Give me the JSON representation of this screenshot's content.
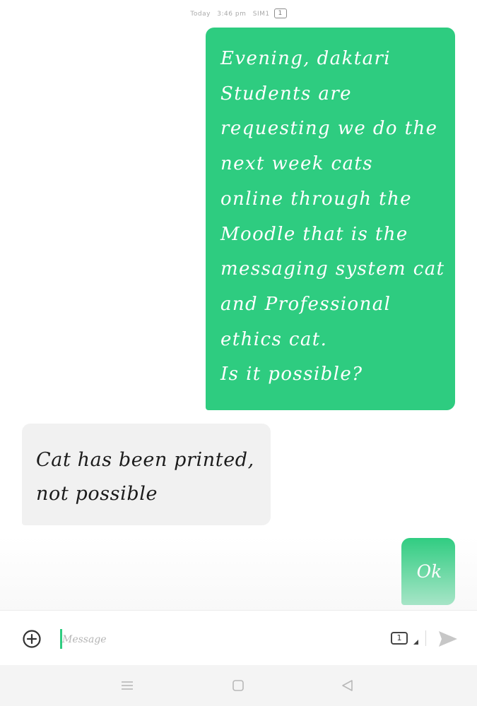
{
  "status_line": {
    "day": "Today",
    "time": "3:46 pm",
    "sim_label": "SIM1",
    "sim_number": "1"
  },
  "messages": [
    {
      "direction": "outgoing",
      "text": "Evening, daktari\nStudents are\nrequesting we do the\nnext week cats\nonline through the\nMoodle that is the\nmessaging system cat\nand Professional\nethics cat.\nIs it possible?"
    },
    {
      "direction": "incoming",
      "text": "Cat has been printed,\nnot possible"
    },
    {
      "direction": "outgoing",
      "text": "Ok"
    }
  ],
  "composer": {
    "placeholder": "Message",
    "value": "",
    "sim_number": "1",
    "add_icon": "plus-circle-icon",
    "send_icon": "send-icon"
  },
  "navbar": {
    "icons": [
      "menu-icon",
      "home-square-icon",
      "back-triangle-icon"
    ]
  },
  "colors": {
    "outgoing_bubble": "#2ecc80",
    "incoming_bubble": "#f1f1f1",
    "accent": "#2ecc80"
  }
}
